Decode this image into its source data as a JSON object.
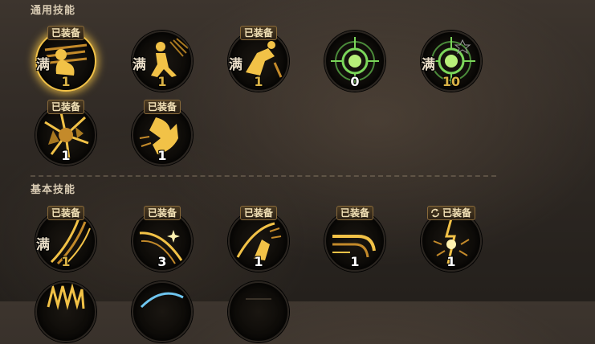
{
  "sections": {
    "general_title": "通用技能",
    "basic_title": "基本技能"
  },
  "labels": {
    "equipped": "已装备",
    "maxed": "满"
  },
  "general_skills": [
    {
      "level": "1",
      "equipped": true,
      "maxed": true,
      "selected": true,
      "icon": "muscle-pose-icon"
    },
    {
      "level": "1",
      "equipped": false,
      "maxed": true,
      "icon": "kneeling-figure-icon"
    },
    {
      "level": "1",
      "equipped": true,
      "maxed": true,
      "icon": "kick-icon"
    },
    {
      "level": "0",
      "equipped": false,
      "maxed": false,
      "icon": "crosshair-icon"
    },
    {
      "level": "10",
      "equipped": false,
      "maxed": true,
      "icon": "crosshair-star-icon"
    },
    {
      "level": "1",
      "equipped": true,
      "maxed": false,
      "icon": "shatter-icon"
    },
    {
      "level": "1",
      "equipped": true,
      "maxed": false,
      "icon": "leap-icon"
    }
  ],
  "basic_skills": [
    {
      "level": "1",
      "equipped": true,
      "maxed": true,
      "icon": "slash-streaks-icon"
    },
    {
      "level": "3",
      "equipped": true,
      "maxed": false,
      "icon": "sparkle-slash-icon"
    },
    {
      "level": "1",
      "equipped": true,
      "maxed": false,
      "icon": "claw-strike-icon"
    },
    {
      "level": "1",
      "equipped": true,
      "maxed": false,
      "icon": "wave-dash-icon"
    },
    {
      "level": "1",
      "equipped": true,
      "maxed": false,
      "sync_tag": true,
      "icon": "lightning-burst-icon"
    }
  ],
  "colors": {
    "gold": "#f2c247",
    "green": "#7bd65a",
    "level_gold": "#d9b246"
  }
}
